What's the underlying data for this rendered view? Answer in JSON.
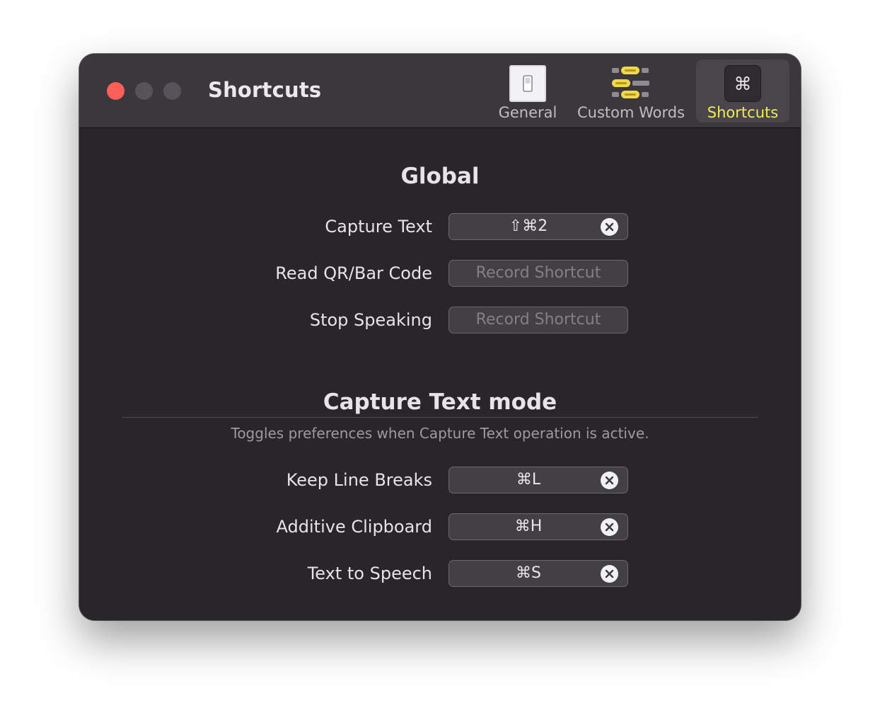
{
  "window": {
    "title": "Shortcuts"
  },
  "toolbar": {
    "tabs": [
      {
        "label": "General",
        "icon": "switch-icon",
        "active": false
      },
      {
        "label": "Custom Words",
        "icon": "custom-words-icon",
        "active": false
      },
      {
        "label": "Shortcuts",
        "icon": "command-icon",
        "active": true
      }
    ]
  },
  "global": {
    "title": "Global",
    "rows": [
      {
        "label": "Capture Text",
        "shortcut": "⇧⌘2",
        "clearable": true
      },
      {
        "label": "Read QR/Bar Code",
        "placeholder": "Record Shortcut",
        "clearable": false
      },
      {
        "label": "Stop Speaking",
        "placeholder": "Record Shortcut",
        "clearable": false
      }
    ]
  },
  "capture_mode": {
    "title": "Capture Text mode",
    "subtitle": "Toggles preferences when Capture Text operation is active.",
    "rows": [
      {
        "label": "Keep Line Breaks",
        "shortcut": "⌘L",
        "clearable": true
      },
      {
        "label": "Additive Clipboard",
        "shortcut": "⌘H",
        "clearable": true
      },
      {
        "label": "Text to Speech",
        "shortcut": "⌘S",
        "clearable": true
      }
    ]
  },
  "colors": {
    "close": "#fe5f57",
    "accent": "#f5e95c",
    "window_bg": "#28252b",
    "titlebar_bg": "#3a373d"
  }
}
